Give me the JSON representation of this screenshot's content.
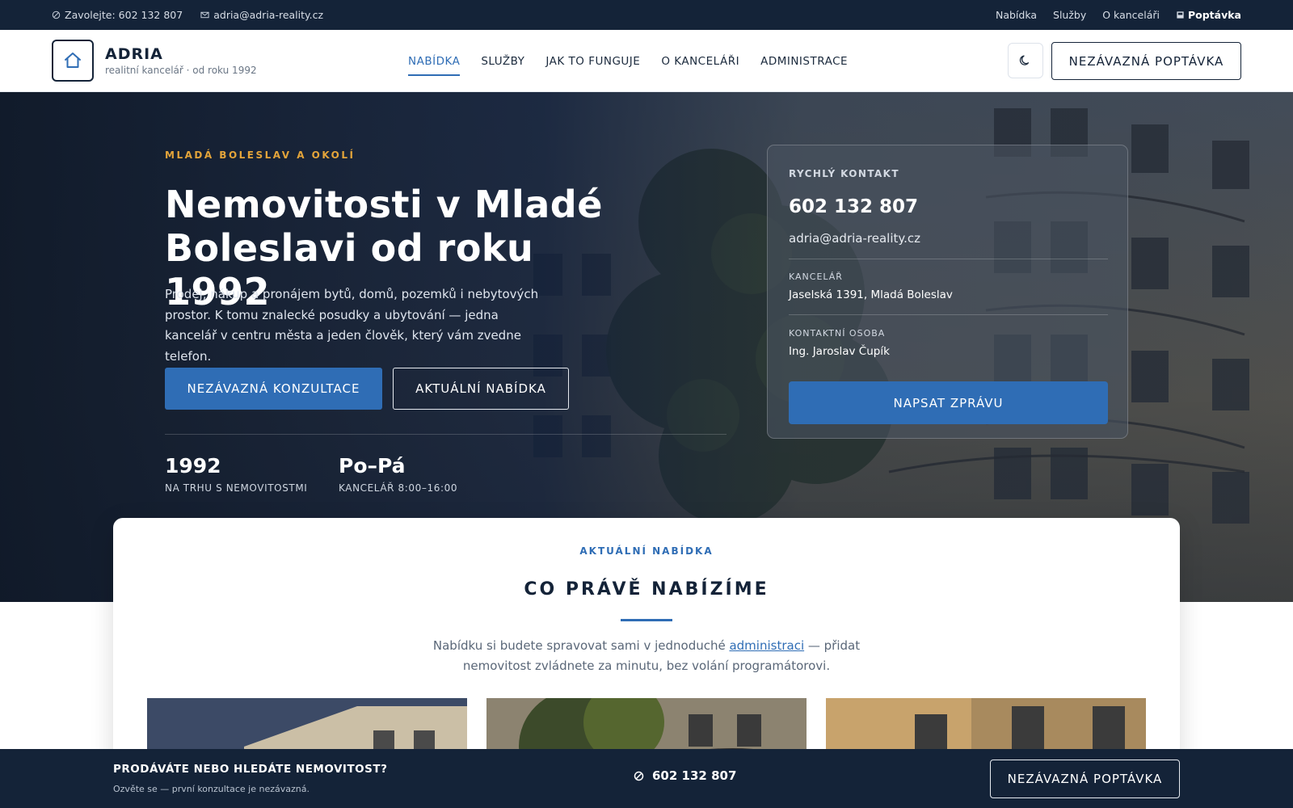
{
  "topbar": {
    "phone_text": "Zavolejte: 602 132 807",
    "email_text": "adria@adria-reality.cz",
    "links": [
      "Nabídka",
      "Služby",
      "O kanceláři"
    ],
    "cta_label": "Poptávka"
  },
  "header": {
    "brand_name": "ADRIA",
    "brand_tagline": "realitní kancelář · od roku 1992",
    "nav": [
      "NABÍDKA",
      "SLUŽBY",
      "JAK TO FUNGUJE",
      "O KANCELÁŘI",
      "ADMINISTRACE"
    ],
    "active_nav": "NABÍDKA",
    "cta_label": "NEZÁVAZNÁ POPTÁVKA",
    "theme_icon": "moon-icon"
  },
  "hero": {
    "eyebrow": "MLADÁ BOLESLAV A OKOLÍ",
    "title": "Nemovitosti v Mladé Boleslavi od roku 1992",
    "text": "Prodej, nákup a pronájem bytů, domů, pozemků i nebytových prostor. K tomu znalecké posudky a ubytování — jedna kancelář v centru města a jeden člověk, který vám zvedne telefon.",
    "primary_button": "NEZÁVAZNÁ KONZULTACE",
    "secondary_button": "AKTUÁLNÍ NABÍDKA",
    "stats": [
      {
        "value": "1992",
        "label": "NA TRHU S NEMOVITOSTMI"
      },
      {
        "value": "Po–Pá",
        "label": "KANCELÁŘ 8:00–16:00"
      }
    ]
  },
  "contact_card": {
    "title": "RYCHLÝ KONTAKT",
    "phone": "602 132 807",
    "email": "adria@adria-reality.cz",
    "office_label": "KANCELÁŘ",
    "office_value": "Jaselská 1391, Mladá Boleslav",
    "person_label": "KONTAKTNÍ OSOBA",
    "person_value": "Ing. Jaroslav Čupík",
    "button": "NAPSAT ZPRÁVU"
  },
  "offer": {
    "eyebrow": "AKTUÁLNÍ NABÍDKA",
    "title": "CO PRÁVĚ NABÍZÍME",
    "text_before": "Nabídku si budete spravovat sami v jednoduché ",
    "text_link": "administraci",
    "text_after": " — přidat nemovitost zvládnete za minutu, bez volání programátorovi."
  },
  "sticky_bar": {
    "title": "PRODÁVÁTE NEBO HLEDÁTE NEMOVITOST?",
    "subtitle": "Ozvěte se — první konzultace je nezávazná.",
    "phone": "602 132 807",
    "cta_label": "NEZÁVAZNÁ POPTÁVKA"
  },
  "colors": {
    "navy": "#142338",
    "accent_blue": "#2f6db5",
    "eyebrow_gold": "#e3a43a"
  }
}
